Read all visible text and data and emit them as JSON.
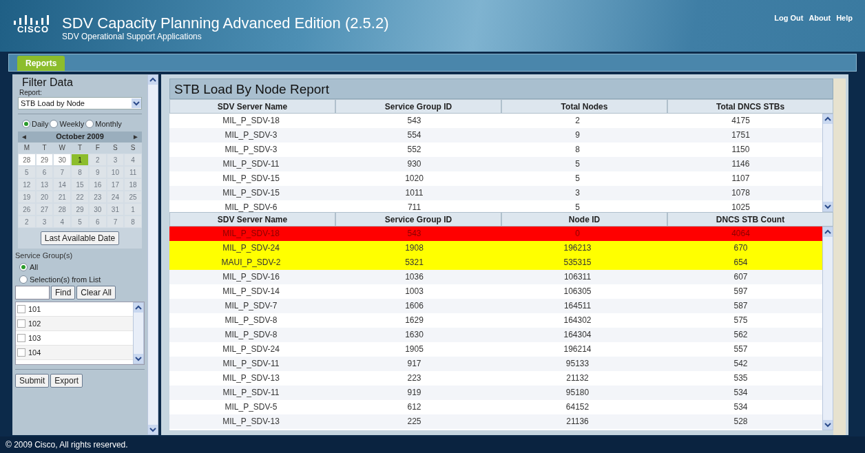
{
  "header": {
    "logo_text": "CISCO",
    "title": "SDV Capacity Planning Advanced Edition (2.5.2)",
    "subtitle": "SDV Operational Support Applications",
    "links": [
      "Log Out",
      "About",
      "Help"
    ]
  },
  "nav": {
    "tabs": [
      {
        "label": "Reports",
        "selected": true
      }
    ]
  },
  "filter": {
    "title": "Filter Data",
    "report_label": "Report:",
    "report_value": "STB Load by Node",
    "periods": [
      {
        "label": "Daily",
        "selected": true
      },
      {
        "label": "Weekly",
        "selected": false
      },
      {
        "label": "Monthly",
        "selected": false
      }
    ],
    "calendar": {
      "prev": "◄",
      "next": "►",
      "month": "October 2009",
      "weekdays": [
        "M",
        "T",
        "W",
        "T",
        "F",
        "S",
        "S"
      ],
      "days": [
        {
          "label": "28",
          "selected": false,
          "disabled": false
        },
        {
          "label": "29",
          "selected": false,
          "disabled": false
        },
        {
          "label": "30",
          "selected": false,
          "disabled": false
        },
        {
          "label": "1",
          "selected": true,
          "disabled": false
        },
        {
          "label": "2",
          "selected": false,
          "disabled": true
        },
        {
          "label": "3",
          "selected": false,
          "disabled": true
        },
        {
          "label": "4",
          "selected": false,
          "disabled": true
        },
        {
          "label": "5",
          "selected": false,
          "disabled": true
        },
        {
          "label": "6",
          "selected": false,
          "disabled": true
        },
        {
          "label": "7",
          "selected": false,
          "disabled": true
        },
        {
          "label": "8",
          "selected": false,
          "disabled": true
        },
        {
          "label": "9",
          "selected": false,
          "disabled": true
        },
        {
          "label": "10",
          "selected": false,
          "disabled": true
        },
        {
          "label": "11",
          "selected": false,
          "disabled": true
        },
        {
          "label": "12",
          "selected": false,
          "disabled": true
        },
        {
          "label": "13",
          "selected": false,
          "disabled": true
        },
        {
          "label": "14",
          "selected": false,
          "disabled": true
        },
        {
          "label": "15",
          "selected": false,
          "disabled": true
        },
        {
          "label": "16",
          "selected": false,
          "disabled": true
        },
        {
          "label": "17",
          "selected": false,
          "disabled": true
        },
        {
          "label": "18",
          "selected": false,
          "disabled": true
        },
        {
          "label": "19",
          "selected": false,
          "disabled": true
        },
        {
          "label": "20",
          "selected": false,
          "disabled": true
        },
        {
          "label": "21",
          "selected": false,
          "disabled": true
        },
        {
          "label": "22",
          "selected": false,
          "disabled": true
        },
        {
          "label": "23",
          "selected": false,
          "disabled": true
        },
        {
          "label": "24",
          "selected": false,
          "disabled": true
        },
        {
          "label": "25",
          "selected": false,
          "disabled": true
        },
        {
          "label": "26",
          "selected": false,
          "disabled": true
        },
        {
          "label": "27",
          "selected": false,
          "disabled": true
        },
        {
          "label": "28",
          "selected": false,
          "disabled": true
        },
        {
          "label": "29",
          "selected": false,
          "disabled": true
        },
        {
          "label": "30",
          "selected": false,
          "disabled": true
        },
        {
          "label": "31",
          "selected": false,
          "disabled": true
        },
        {
          "label": "1",
          "selected": false,
          "disabled": true
        },
        {
          "label": "2",
          "selected": false,
          "disabled": true
        },
        {
          "label": "3",
          "selected": false,
          "disabled": true
        },
        {
          "label": "4",
          "selected": false,
          "disabled": true
        },
        {
          "label": "5",
          "selected": false,
          "disabled": true
        },
        {
          "label": "6",
          "selected": false,
          "disabled": true
        },
        {
          "label": "7",
          "selected": false,
          "disabled": true
        },
        {
          "label": "8",
          "selected": false,
          "disabled": true
        }
      ]
    },
    "last_date_button": "Last Available Date",
    "service_groups_label": "Service Group(s)",
    "group_modes": [
      {
        "label": "All",
        "selected": true
      },
      {
        "label": "Selection(s) from List",
        "selected": false
      }
    ],
    "find_button": "Find",
    "clear_button": "Clear All",
    "groups": [
      {
        "label": "101",
        "checked": false
      },
      {
        "label": "102",
        "checked": false
      },
      {
        "label": "103",
        "checked": false
      },
      {
        "label": "104",
        "checked": false
      }
    ],
    "submit_button": "Submit",
    "export_button": "Export"
  },
  "report": {
    "title": "STB Load By Node Report",
    "summary": {
      "columns": [
        "SDV Server Name",
        "Service Group ID",
        "Total Nodes",
        "Total DNCS STBs"
      ],
      "rows": [
        [
          "MIL_P_SDV-18",
          "543",
          "2",
          "4175"
        ],
        [
          "MIL_P_SDV-3",
          "554",
          "9",
          "1751"
        ],
        [
          "MIL_P_SDV-3",
          "552",
          "8",
          "1150"
        ],
        [
          "MIL_P_SDV-11",
          "930",
          "5",
          "1146"
        ],
        [
          "MIL_P_SDV-15",
          "1020",
          "5",
          "1107"
        ],
        [
          "MIL_P_SDV-15",
          "1011",
          "3",
          "1078"
        ],
        [
          "MIL_P_SDV-6",
          "711",
          "5",
          "1025"
        ]
      ]
    },
    "detail": {
      "columns": [
        "SDV Server Name",
        "Service Group ID",
        "Node ID",
        "DNCS STB Count"
      ],
      "rows": [
        {
          "cells": [
            "MIL_P_SDV-18",
            "543",
            "0",
            "4064"
          ],
          "color": "#ff0000"
        },
        {
          "cells": [
            "MIL_P_SDV-24",
            "1908",
            "196213",
            "670"
          ],
          "color": "#ffff00"
        },
        {
          "cells": [
            "MAUI_P_SDV-2",
            "5321",
            "535315",
            "654"
          ],
          "color": "#ffff00"
        },
        {
          "cells": [
            "MIL_P_SDV-16",
            "1036",
            "106311",
            "607"
          ]
        },
        {
          "cells": [
            "MIL_P_SDV-14",
            "1003",
            "106305",
            "597"
          ]
        },
        {
          "cells": [
            "MIL_P_SDV-7",
            "1606",
            "164511",
            "587"
          ]
        },
        {
          "cells": [
            "MIL_P_SDV-8",
            "1629",
            "164302",
            "575"
          ]
        },
        {
          "cells": [
            "MIL_P_SDV-8",
            "1630",
            "164304",
            "562"
          ]
        },
        {
          "cells": [
            "MIL_P_SDV-24",
            "1905",
            "196214",
            "557"
          ]
        },
        {
          "cells": [
            "MIL_P_SDV-11",
            "917",
            "95133",
            "542"
          ]
        },
        {
          "cells": [
            "MIL_P_SDV-13",
            "223",
            "21132",
            "535"
          ]
        },
        {
          "cells": [
            "MIL_P_SDV-11",
            "919",
            "95180",
            "534"
          ]
        },
        {
          "cells": [
            "MIL_P_SDV-5",
            "612",
            "64152",
            "534"
          ]
        },
        {
          "cells": [
            "MIL_P_SDV-13",
            "225",
            "21136",
            "528"
          ]
        }
      ]
    }
  },
  "footer": "© 2009 Cisco, All rights reserved."
}
